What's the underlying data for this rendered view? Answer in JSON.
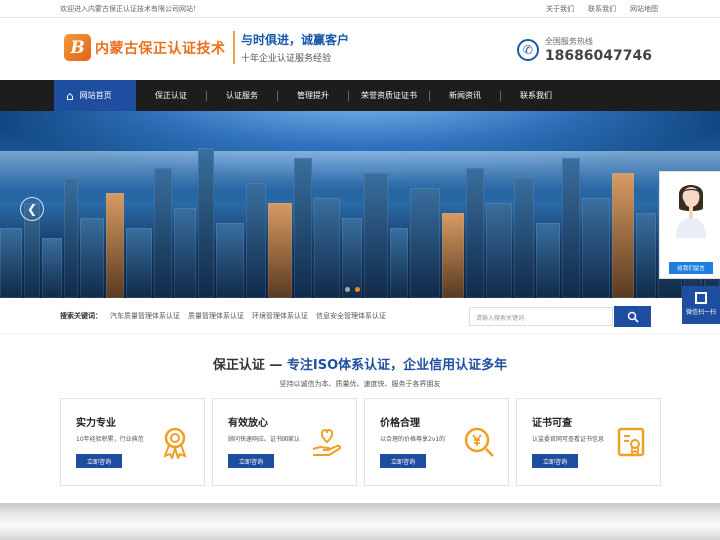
{
  "topbar": {
    "welcome": "欢迎进入内蒙古保正认证技术有限公司网站！",
    "links": [
      "关于我们",
      "联系我们",
      "网站地图"
    ]
  },
  "header": {
    "logo_text": "内蒙古保正认证技术",
    "slogan_main": "与时俱进，诚赢客户",
    "slogan_sub": "十年企业认证服务经验",
    "hotline_label": "全国服务热线",
    "hotline_number": "18686047746"
  },
  "nav": {
    "items": [
      "网站首页",
      "保正认证",
      "认证服务",
      "管理提升",
      "荣誉资质证证书",
      "新闻资讯",
      "联系我们"
    ]
  },
  "search": {
    "label": "搜索关键词：",
    "keywords": [
      "汽车质量管理体系认证",
      "质量管理体系认证",
      "环境管理体系认证",
      "信息安全管理体系认证"
    ],
    "placeholder": "请输入搜索关键词"
  },
  "section": {
    "title_a": "保正认证 — ",
    "title_b": "专注ISO体系认证，企业信用认证多年",
    "subtitle": "坚持以诚信为本、质量优、速度快、服务于各界朋友"
  },
  "cards": [
    {
      "title": "实力专业",
      "desc": "10年经验积累，行业典范",
      "button": "立即咨询",
      "icon": "medal-icon"
    },
    {
      "title": "有效放心",
      "desc": "顾问快速响应。证书国家认",
      "button": "立即咨询",
      "icon": "heart-hand-icon"
    },
    {
      "title": "价格合理",
      "desc": "以合理的价格尊享2v1的",
      "button": "立即咨询",
      "icon": "yen-coin-icon"
    },
    {
      "title": "证书可查",
      "desc": "认监委官网可查看证书信息",
      "button": "立即咨询",
      "icon": "certificate-icon"
    }
  ],
  "float": {
    "message_button": "给我们留言",
    "wechat_label": "微信扫一扫"
  },
  "colors": {
    "primary": "#1f4ea0",
    "accent": "#e8701f",
    "nav_bg": "#1d1d1d"
  }
}
